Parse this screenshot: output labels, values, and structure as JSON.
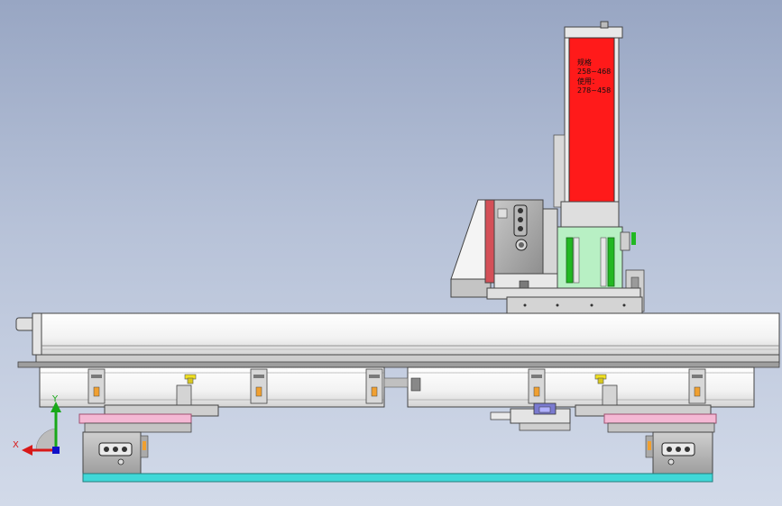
{
  "viewport": {
    "background_top": "#98a6c3",
    "background_bottom": "#d2dae9"
  },
  "column": {
    "label_lines": [
      "规格",
      "258~468",
      "使用：",
      "278~458"
    ],
    "fill_color": "#ff1a1a",
    "text_color": "#111111"
  },
  "triad": {
    "x_label": "X",
    "y_label": "Y",
    "x_color": "#d81818",
    "y_color": "#18a818",
    "z_color": "#1010c8"
  },
  "colors": {
    "green_plate": "#b8f0c4",
    "green_bar": "#22b822",
    "pink_pad": "#f4b8d4",
    "cyan_base": "#40d8d8",
    "yellow_marker": "#f0e020",
    "orange_tab": "#f0a030",
    "red_plate": "#d45058"
  }
}
